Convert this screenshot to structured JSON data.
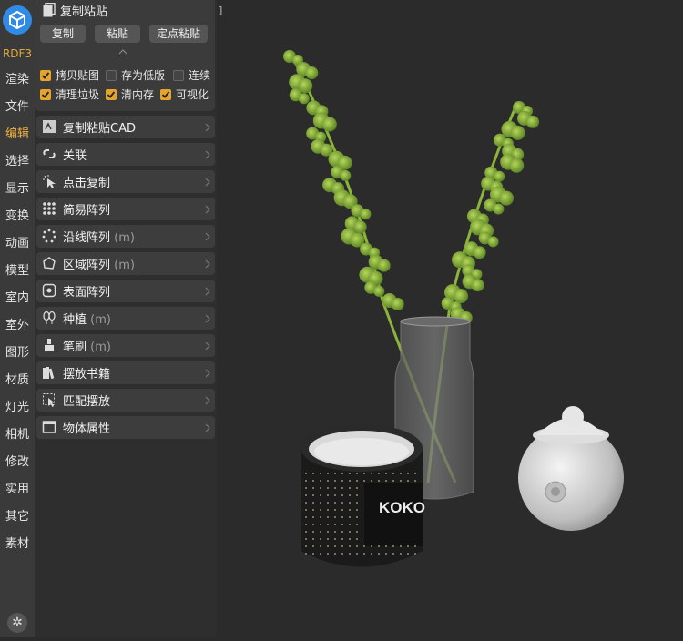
{
  "app": {
    "version": "RDF3"
  },
  "rail": {
    "items": [
      "渲染",
      "文件",
      "编辑",
      "选择",
      "显示",
      "变换",
      "动画",
      "模型",
      "室内",
      "室外",
      "图形",
      "材质",
      "灯光",
      "相机",
      "修改",
      "实用",
      "其它",
      "素材"
    ],
    "active": "编辑"
  },
  "copy_paste": {
    "title": "复制粘贴",
    "buttons": {
      "copy": "复制",
      "paste": "粘贴",
      "point_paste": "定点粘贴"
    },
    "options": [
      {
        "label": "拷贝贴图",
        "checked": true
      },
      {
        "label": "存为低版",
        "checked": false
      },
      {
        "label": "连续",
        "checked": false
      },
      {
        "label": "清理垃圾",
        "checked": true
      },
      {
        "label": "清内存",
        "checked": true
      },
      {
        "label": "可视化",
        "checked": true
      }
    ]
  },
  "rows": [
    {
      "label": "复制粘贴CAD",
      "suffix": "",
      "icon": "cad-icon"
    },
    {
      "label": "关联",
      "suffix": "",
      "icon": "link-icon"
    },
    {
      "label": "点击复制",
      "suffix": "",
      "icon": "click-copy-icon"
    },
    {
      "label": "简易阵列",
      "suffix": "",
      "icon": "grid-array-icon"
    },
    {
      "label": "沿线阵列",
      "suffix": "(m)",
      "icon": "path-array-icon"
    },
    {
      "label": "区域阵列",
      "suffix": "(m)",
      "icon": "area-array-icon"
    },
    {
      "label": "表面阵列",
      "suffix": "",
      "icon": "surface-array-icon"
    },
    {
      "label": "种植",
      "suffix": "(m)",
      "icon": "plant-icon"
    },
    {
      "label": "笔刷",
      "suffix": "(m)",
      "icon": "brush-icon"
    },
    {
      "label": "摆放书籍",
      "suffix": "",
      "icon": "books-icon"
    },
    {
      "label": "匹配摆放",
      "suffix": "",
      "icon": "match-place-icon"
    },
    {
      "label": "物体属性",
      "suffix": "",
      "icon": "properties-icon"
    }
  ],
  "viewport": {
    "corner_label": "]",
    "candle_text": "KOKO"
  },
  "colors": {
    "accent": "#e5a52c",
    "logo": "#2f8be6"
  }
}
